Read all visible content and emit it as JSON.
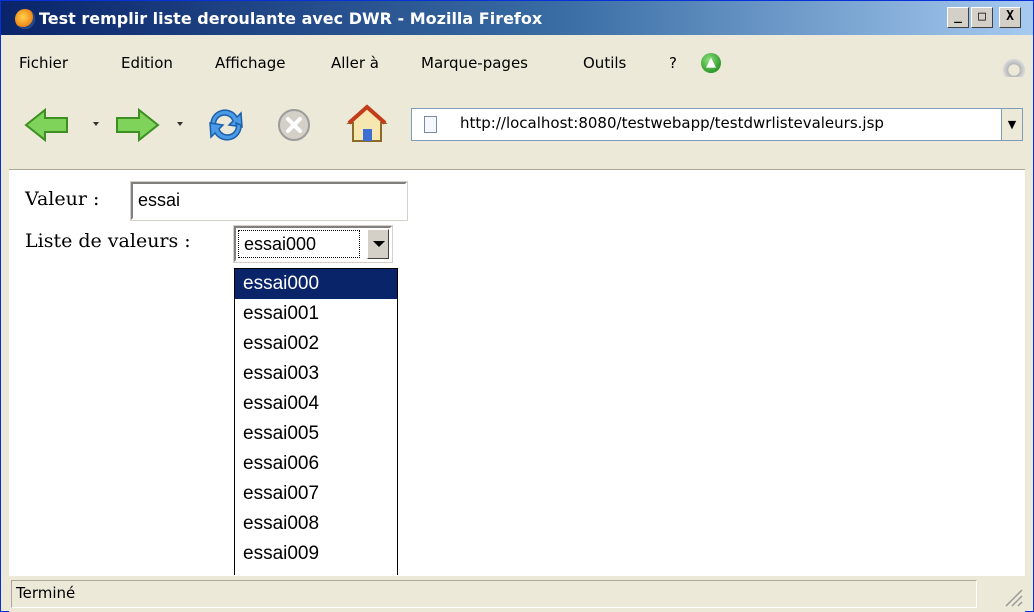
{
  "window": {
    "title": "Test remplir liste deroulante avec DWR - Mozilla Firefox",
    "controls": {
      "minimize": "_",
      "maximize": "□",
      "close": "X"
    }
  },
  "menu": {
    "items": [
      "Fichier",
      "Edition",
      "Affichage",
      "Aller à",
      "Marque-pages",
      "Outils",
      "?"
    ]
  },
  "toolbar": {
    "url": "http://localhost:8080/testwebapp/testdwrlistevaleurs.jsp",
    "icons": [
      "back-icon",
      "forward-icon",
      "reload-icon",
      "stop-icon",
      "home-icon"
    ]
  },
  "page": {
    "valeur_label": "Valeur :",
    "valeur_value": "essai",
    "liste_label": "Liste de valeurs :",
    "selected_value": "essai000",
    "options": [
      "essai000",
      "essai001",
      "essai002",
      "essai003",
      "essai004",
      "essai005",
      "essai006",
      "essai007",
      "essai008",
      "essai009"
    ],
    "highlighted_index": 0
  },
  "status": {
    "text": "Terminé"
  },
  "colors": {
    "titlebar": "#0a246a",
    "selection": "#0a246a",
    "chrome": "#ece9d8"
  }
}
